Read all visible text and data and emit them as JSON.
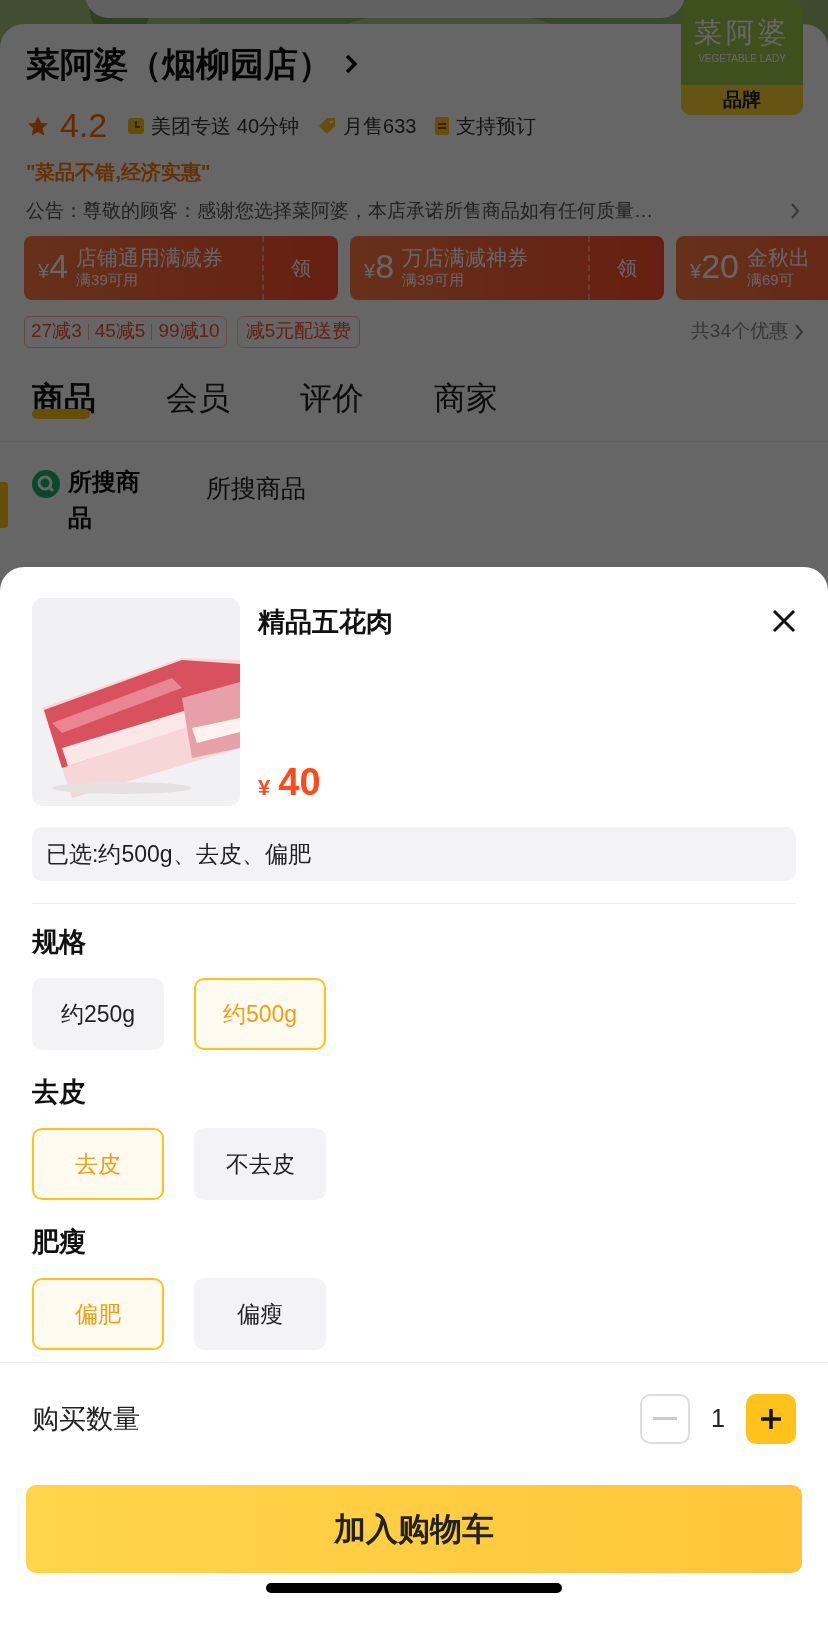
{
  "store": {
    "name": "菜阿婆（烟柳园店）",
    "logo": {
      "text": "菜阿婆",
      "subtext": "VEGETABLE LADY",
      "badge": "品牌"
    },
    "rating": "4.2",
    "meta": [
      {
        "kind": "delivery",
        "text": "美团专送 40分钟"
      },
      {
        "kind": "sales",
        "text": "月售633"
      },
      {
        "kind": "reserve",
        "text": "支持预订"
      }
    ],
    "slogan": "\"菜品不错,经济实惠\"",
    "notice": "公告：尊敬的顾客：感谢您选择菜阿婆，本店承诺所售商品如有任何质量…"
  },
  "coupons": [
    {
      "currency": "¥",
      "amount": "4",
      "title": "店铺通用满减券",
      "condition": "满39可用",
      "action": "领"
    },
    {
      "currency": "¥",
      "amount": "8",
      "title": "万店满减神券",
      "condition": "满39可用",
      "action": "领"
    },
    {
      "currency": "¥",
      "amount": "20",
      "title": "金秋出",
      "condition": "满69可"
    }
  ],
  "promos": {
    "tiers": [
      "27减3",
      "45减5",
      "99减10"
    ],
    "delivery": "减5元配送费",
    "total": "共34个优惠"
  },
  "tabs": [
    {
      "label": "商品",
      "selected": true
    },
    {
      "label": "会员",
      "selected": false
    },
    {
      "label": "评价",
      "selected": false
    },
    {
      "label": "商家",
      "selected": false
    }
  ],
  "category": {
    "selected_item": "所搜商品",
    "heading": "所搜商品"
  },
  "sheet": {
    "title": "精品五花肉",
    "currency": "¥",
    "price": "40",
    "selection": "已选:约500g、去皮、偏肥",
    "groups": [
      {
        "label": "规格",
        "options": [
          {
            "label": "约250g",
            "selected": false
          },
          {
            "label": "约500g",
            "selected": true
          }
        ]
      },
      {
        "label": "去皮",
        "options": [
          {
            "label": "去皮",
            "selected": true
          },
          {
            "label": "不去皮",
            "selected": false
          }
        ]
      },
      {
        "label": "肥瘦",
        "options": [
          {
            "label": "偏肥",
            "selected": true
          },
          {
            "label": "偏瘦",
            "selected": false
          }
        ]
      }
    ],
    "quantity": {
      "label": "购买数量",
      "value": "1"
    },
    "cart_button": "加入购物车"
  }
}
